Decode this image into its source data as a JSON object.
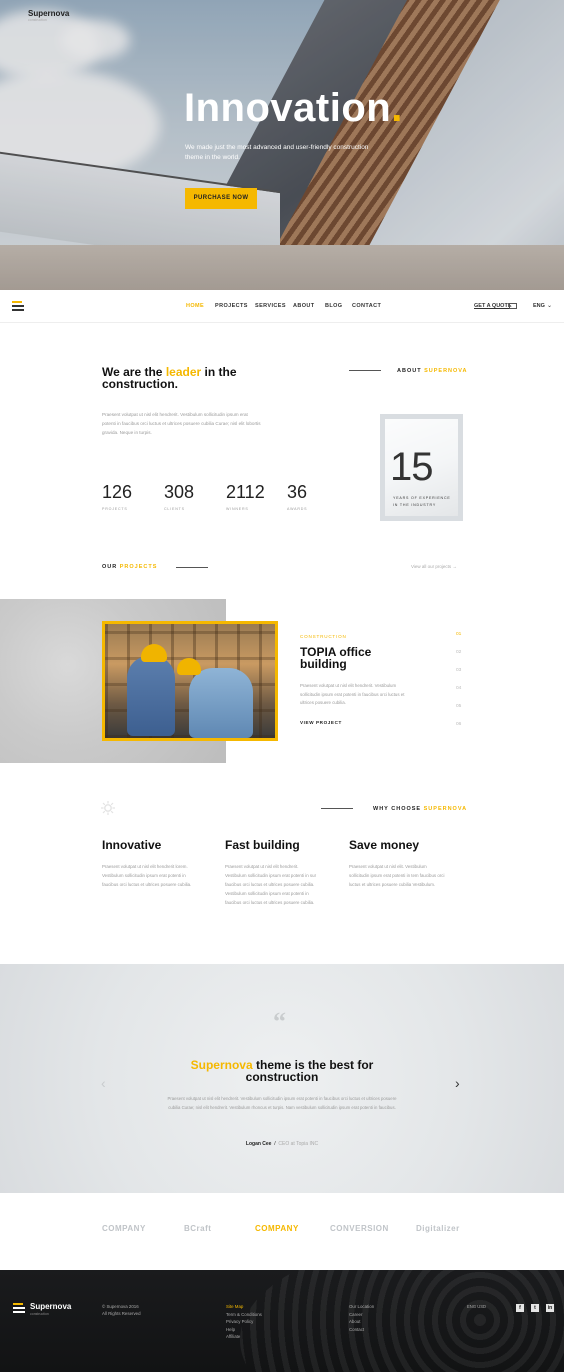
{
  "hero": {
    "title": "Innovation",
    "title_dot": ".",
    "subtitle": "We made just the most advanced and user-friendly construction theme in the world.",
    "button": "PURCHASE NOW"
  },
  "nav": {
    "brand": "Supernova",
    "brand_sub": "construction",
    "items": [
      "HOME",
      "PROJECTS",
      "SERVICES",
      "ABOUT",
      "BLOG",
      "CONTACT"
    ],
    "active": "HOME",
    "quote": "GET A QUOTE",
    "lang": "ENG"
  },
  "about": {
    "title_pre": "We are the ",
    "title_hl": "leader",
    "title_post": " in the construction.",
    "label_pre": "ABOUT ",
    "label_hl": "SUPERNOVA",
    "text": "Praesent volutpat ut nisl elit hendrerit. Vestibulum sollicitudin ipsum erat potenti in faucibus orci luctus et ultrices posuere cubilia Curae; nisl elit lobortis gravida. Neque in turpis.",
    "stats": [
      {
        "value": "126",
        "label": "PROJECTS"
      },
      {
        "value": "308",
        "label": "CLIENTS"
      },
      {
        "value": "2112",
        "label": "WINNERS"
      },
      {
        "value": "36",
        "label": "AWARDS"
      }
    ],
    "years": "15",
    "years_text_1": "YEARS OF EXPERIENCE",
    "years_text_2": "IN THE INDUSTRY"
  },
  "projects": {
    "label_pre": "OUR ",
    "label_hl": "PROJECTS",
    "view_all": "View all our projects",
    "category": "CONSTRUCTION",
    "title": "TOPIA office building",
    "text": "Praesent volutpat ut nisl elit hendrerit. Vestibulum sollicitudin ipsum erat potenti in faucibus orci luctus et ultrices posuere cubilia.",
    "view": "VIEW PROJECT",
    "pages": [
      "01",
      "02",
      "03",
      "04",
      "05",
      "06"
    ]
  },
  "why": {
    "label_pre": "WHY CHOOSE ",
    "label_hl": "SUPERNOVA",
    "items": [
      {
        "title": "Innovative",
        "text": "Praesent volutpat ut nisl elit hendrerit lorem. Vestibulum sollicitudin ipsum erat potenti in faucibus orci luctus et ultrices posuere cubilia."
      },
      {
        "title": "Fast building",
        "text": "Praesent volutpat ut nisl elit hendrerit. Vestibulum sollicitudin ipsum erat potenti in sur faucibus orci luctus et ultrices posuere cubilia. Vestibulum sollicitudin ipsum erat potenti in faucibus orci luctus et ultrices posuere cubilia."
      },
      {
        "title": "Save money",
        "text": "Praesent volutpat ut nisl elit. Vestibulum sollicitudin ipsum erat potenti in tem faucibus orci luctus et ultrices posuere cubilia Vestibulum."
      }
    ]
  },
  "testimonial": {
    "title_hl": "Supernova",
    "title_post": " theme is the best for construction",
    "text": "Praesent volutpat ut nisl elit hendrerit. Vestibulum sollicitudin ipsum erat potenti in faucibus orci luctus et ultrices posuere cubilia Curae; nisl elit hendrerit. Vestibulum rhoncus et turpis. Nam vestibulum sollicitudin ipsum erat potenti in faucibus.",
    "author": "Logan Cee",
    "role": "CEO at Topia INC"
  },
  "logos": [
    "COMPANY",
    "BCraft",
    "COMPANY",
    "CONVERSION",
    "Digitalizer"
  ],
  "footer": {
    "brand": "Supernova",
    "brand_sub": "construction",
    "copy_1": "© Supernova 2016",
    "copy_2": "All Rights Reserved",
    "links1": [
      "Site Map",
      "Term & Conditions",
      "Privacy Policy",
      "Help",
      "Affiliate"
    ],
    "links2": [
      "Our Location",
      "Career",
      "About",
      "Contact"
    ],
    "lang": "ENG    USD",
    "social": [
      "f",
      "t",
      "in"
    ]
  },
  "colors": {
    "accent": "#f5b800",
    "dark": "#141516"
  }
}
